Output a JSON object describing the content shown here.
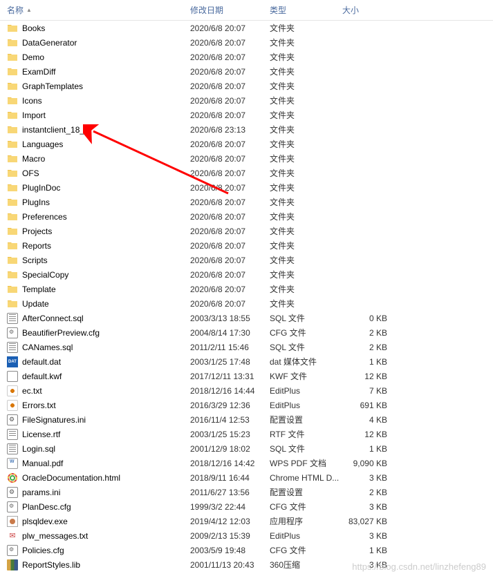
{
  "columns": {
    "name": "名称",
    "date": "修改日期",
    "type": "类型",
    "size": "大小"
  },
  "files": [
    {
      "name": "Books",
      "date": "2020/6/8 20:07",
      "type": "文件夹",
      "size": "",
      "icon": "folder"
    },
    {
      "name": "DataGenerator",
      "date": "2020/6/8 20:07",
      "type": "文件夹",
      "size": "",
      "icon": "folder"
    },
    {
      "name": "Demo",
      "date": "2020/6/8 20:07",
      "type": "文件夹",
      "size": "",
      "icon": "folder"
    },
    {
      "name": "ExamDiff",
      "date": "2020/6/8 20:07",
      "type": "文件夹",
      "size": "",
      "icon": "folder"
    },
    {
      "name": "GraphTemplates",
      "date": "2020/6/8 20:07",
      "type": "文件夹",
      "size": "",
      "icon": "folder"
    },
    {
      "name": "Icons",
      "date": "2020/6/8 20:07",
      "type": "文件夹",
      "size": "",
      "icon": "folder"
    },
    {
      "name": "Import",
      "date": "2020/6/8 20:07",
      "type": "文件夹",
      "size": "",
      "icon": "folder"
    },
    {
      "name": "instantclient_18_5",
      "date": "2020/6/8 23:13",
      "type": "文件夹",
      "size": "",
      "icon": "folder"
    },
    {
      "name": "Languages",
      "date": "2020/6/8 20:07",
      "type": "文件夹",
      "size": "",
      "icon": "folder"
    },
    {
      "name": "Macro",
      "date": "2020/6/8 20:07",
      "type": "文件夹",
      "size": "",
      "icon": "folder"
    },
    {
      "name": "OFS",
      "date": "2020/6/8 20:07",
      "type": "文件夹",
      "size": "",
      "icon": "folder"
    },
    {
      "name": "PlugInDoc",
      "date": "2020/6/8 20:07",
      "type": "文件夹",
      "size": "",
      "icon": "folder"
    },
    {
      "name": "PlugIns",
      "date": "2020/6/8 20:07",
      "type": "文件夹",
      "size": "",
      "icon": "folder"
    },
    {
      "name": "Preferences",
      "date": "2020/6/8 20:07",
      "type": "文件夹",
      "size": "",
      "icon": "folder"
    },
    {
      "name": "Projects",
      "date": "2020/6/8 20:07",
      "type": "文件夹",
      "size": "",
      "icon": "folder"
    },
    {
      "name": "Reports",
      "date": "2020/6/8 20:07",
      "type": "文件夹",
      "size": "",
      "icon": "folder"
    },
    {
      "name": "Scripts",
      "date": "2020/6/8 20:07",
      "type": "文件夹",
      "size": "",
      "icon": "folder"
    },
    {
      "name": "SpecialCopy",
      "date": "2020/6/8 20:07",
      "type": "文件夹",
      "size": "",
      "icon": "folder"
    },
    {
      "name": "Template",
      "date": "2020/6/8 20:07",
      "type": "文件夹",
      "size": "",
      "icon": "folder"
    },
    {
      "name": "Update",
      "date": "2020/6/8 20:07",
      "type": "文件夹",
      "size": "",
      "icon": "folder"
    },
    {
      "name": "AfterConnect.sql",
      "date": "2003/3/13 18:55",
      "type": "SQL 文件",
      "size": "0 KB",
      "icon": "sql"
    },
    {
      "name": "BeautifierPreview.cfg",
      "date": "2004/8/14 17:30",
      "type": "CFG 文件",
      "size": "2 KB",
      "icon": "cfg"
    },
    {
      "name": "CANames.sql",
      "date": "2011/2/11 15:46",
      "type": "SQL 文件",
      "size": "2 KB",
      "icon": "sql"
    },
    {
      "name": "default.dat",
      "date": "2003/1/25 17:48",
      "type": "dat 媒体文件",
      "size": "1 KB",
      "icon": "dat"
    },
    {
      "name": "default.kwf",
      "date": "2017/12/11 13:31",
      "type": "KWF 文件",
      "size": "12 KB",
      "icon": "kwf"
    },
    {
      "name": "ec.txt",
      "date": "2018/12/16 14:44",
      "type": "EditPlus",
      "size": "7 KB",
      "icon": "editplus"
    },
    {
      "name": "Errors.txt",
      "date": "2016/3/29 12:36",
      "type": "EditPlus",
      "size": "691 KB",
      "icon": "editplus"
    },
    {
      "name": "FileSignatures.ini",
      "date": "2016/11/4 12:53",
      "type": "配置设置",
      "size": "4 KB",
      "icon": "ini"
    },
    {
      "name": "License.rtf",
      "date": "2003/1/25 15:23",
      "type": "RTF 文件",
      "size": "12 KB",
      "icon": "rtf"
    },
    {
      "name": "Login.sql",
      "date": "2001/12/9 18:02",
      "type": "SQL 文件",
      "size": "1 KB",
      "icon": "sql"
    },
    {
      "name": "Manual.pdf",
      "date": "2018/12/16 14:42",
      "type": "WPS PDF 文档",
      "size": "9,090 KB",
      "icon": "pdf"
    },
    {
      "name": "OracleDocumentation.html",
      "date": "2018/9/11 16:44",
      "type": "Chrome HTML D...",
      "size": "3 KB",
      "icon": "html"
    },
    {
      "name": "params.ini",
      "date": "2011/6/27 13:56",
      "type": "配置设置",
      "size": "2 KB",
      "icon": "ini"
    },
    {
      "name": "PlanDesc.cfg",
      "date": "1999/3/2 22:44",
      "type": "CFG 文件",
      "size": "3 KB",
      "icon": "cfg"
    },
    {
      "name": "plsqldev.exe",
      "date": "2019/4/12 12:03",
      "type": "应用程序",
      "size": "83,027 KB",
      "icon": "exe"
    },
    {
      "name": "plw_messages.txt",
      "date": "2009/2/13 15:39",
      "type": "EditPlus",
      "size": "3 KB",
      "icon": "messages"
    },
    {
      "name": "Policies.cfg",
      "date": "2003/5/9 19:48",
      "type": "CFG 文件",
      "size": "1 KB",
      "icon": "cfg"
    },
    {
      "name": "ReportStyles.lib",
      "date": "2001/11/13 20:43",
      "type": "360压缩",
      "size": "3 KB",
      "icon": "lib"
    }
  ],
  "watermark": "https://blog.csdn.net/linzhefeng89"
}
